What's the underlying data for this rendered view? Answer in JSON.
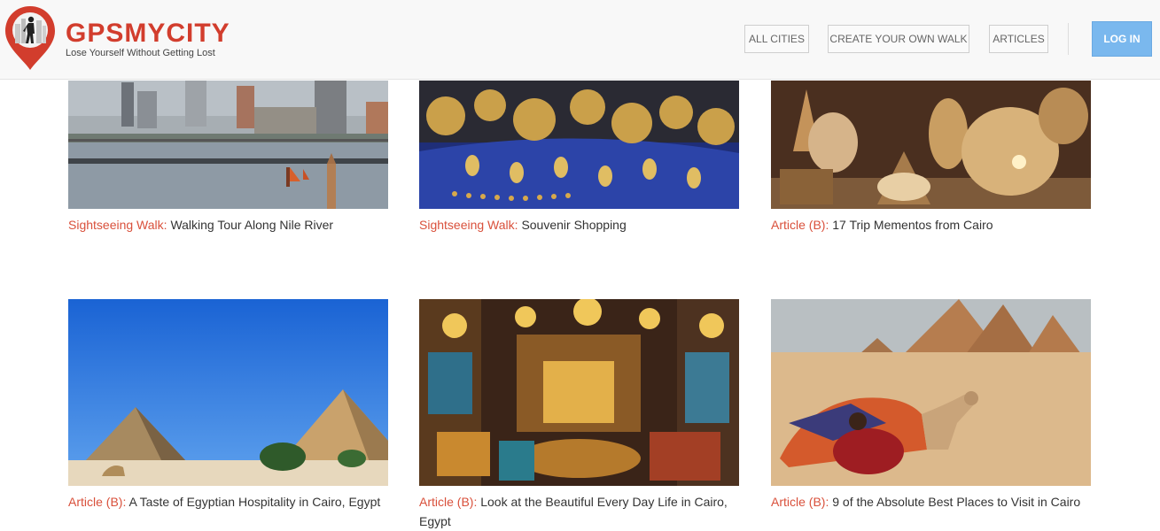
{
  "brand": {
    "name": "GPSMYCITY",
    "tagline": "Lose Yourself Without Getting Lost",
    "color": "#d23d2d"
  },
  "nav": {
    "all_cities": "ALL CITIES",
    "create_walk": "CREATE YOUR OWN WALK",
    "articles": "ARTICLES",
    "login": "LOG IN"
  },
  "cards": [
    {
      "kind": "Sightseeing Walk:",
      "title": "Walking Tour Along Nile River",
      "image": "nile-river-city-photo"
    },
    {
      "kind": "Sightseeing Walk:",
      "title": "Souvenir Shopping",
      "image": "golden-coins-jewelry-photo"
    },
    {
      "kind": "Article (B):",
      "title": "17 Trip Mementos from Cairo",
      "image": "brass-lanterns-photo"
    },
    {
      "kind": "Article (B):",
      "title": "A Taste of Egyptian Hospitality in Cairo, Egypt",
      "image": "giza-pyramids-blue-sky-photo"
    },
    {
      "kind": "Article (B):",
      "title": "Look at the Beautiful Every Day Life in Cairo, Egypt",
      "image": "bazaar-shop-interior-photo"
    },
    {
      "kind": "Article (B):",
      "title": "9 of the Absolute Best Places to Visit in Cairo",
      "image": "camel-woman-pyramids-photo"
    }
  ],
  "colors": {
    "accent": "#d9503b",
    "login_bg": "#7ab8ee"
  }
}
